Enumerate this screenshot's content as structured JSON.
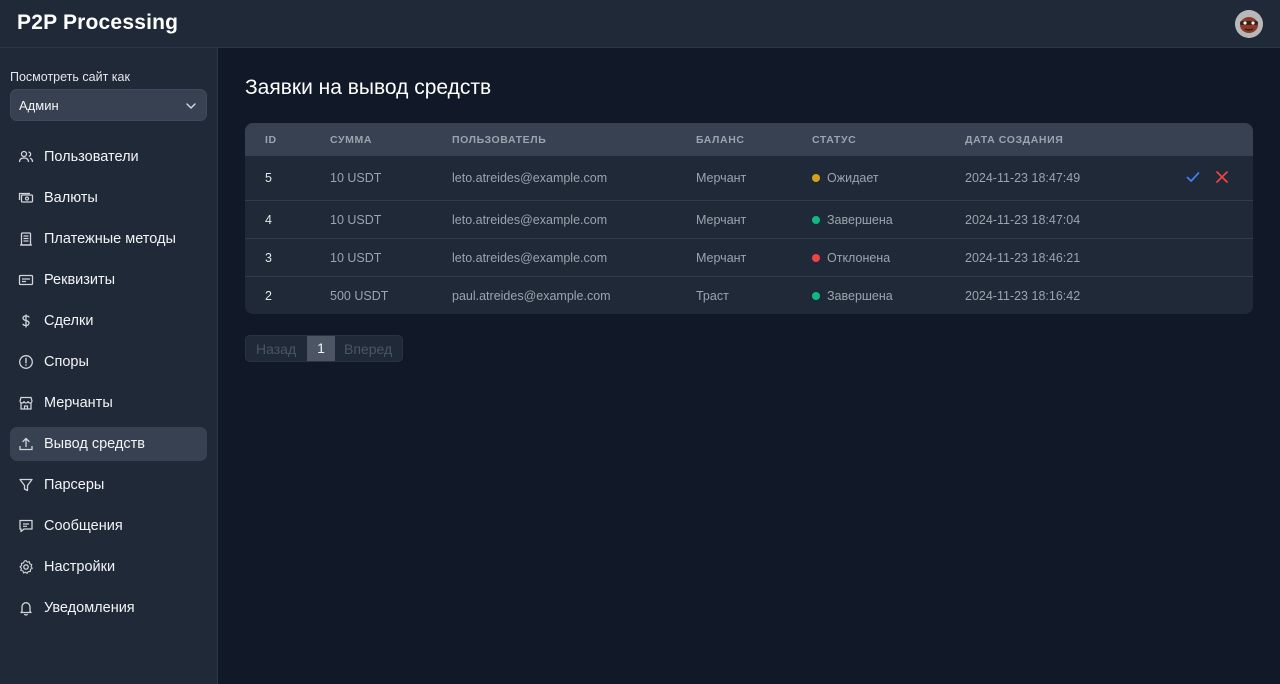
{
  "app": {
    "title": "P2P Processing"
  },
  "sidebar": {
    "view_as_label": "Посмотреть сайт как",
    "role_selected": "Админ",
    "items": [
      {
        "label": "Пользователи",
        "icon": "users-icon"
      },
      {
        "label": "Валюты",
        "icon": "banknote-icon"
      },
      {
        "label": "Платежные методы",
        "icon": "bank-icon"
      },
      {
        "label": "Реквизиты",
        "icon": "credit-card-icon"
      },
      {
        "label": "Сделки",
        "icon": "dollar-icon"
      },
      {
        "label": "Споры",
        "icon": "alert-circle-icon"
      },
      {
        "label": "Мерчанты",
        "icon": "store-icon"
      },
      {
        "label": "Вывод средств",
        "icon": "upload-icon",
        "active": true
      },
      {
        "label": "Парсеры",
        "icon": "filter-icon"
      },
      {
        "label": "Сообщения",
        "icon": "message-icon"
      },
      {
        "label": "Настройки",
        "icon": "gear-icon"
      },
      {
        "label": "Уведомления",
        "icon": "bell-icon"
      }
    ]
  },
  "main": {
    "title": "Заявки на вывод средств",
    "table": {
      "headers": [
        "ID",
        "СУММА",
        "ПОЛЬЗОВАТЕЛЬ",
        "БАЛАНС",
        "СТАТУС",
        "ДАТА СОЗДАНИЯ"
      ],
      "rows": [
        {
          "id": "5",
          "amount": "10 USDT",
          "user": "leto.atreides@example.com",
          "balance": "Мерчант",
          "status": "Ожидает",
          "status_color": "#d4a017",
          "date": "2024-11-23 18:47:49",
          "actions": true
        },
        {
          "id": "4",
          "amount": "10 USDT",
          "user": "leto.atreides@example.com",
          "balance": "Мерчант",
          "status": "Завершена",
          "status_color": "#10b981",
          "date": "2024-11-23 18:47:04"
        },
        {
          "id": "3",
          "amount": "10 USDT",
          "user": "leto.atreides@example.com",
          "balance": "Мерчант",
          "status": "Отклонена",
          "status_color": "#ef4444",
          "date": "2024-11-23 18:46:21"
        },
        {
          "id": "2",
          "amount": "500 USDT",
          "user": "paul.atreides@example.com",
          "balance": "Траст",
          "status": "Завершена",
          "status_color": "#10b981",
          "date": "2024-11-23 18:16:42"
        }
      ]
    },
    "pagination": {
      "prev": "Назад",
      "current": "1",
      "next": "Вперед"
    }
  },
  "colors": {
    "approve": "#3b82f6",
    "reject": "#ef4444"
  }
}
